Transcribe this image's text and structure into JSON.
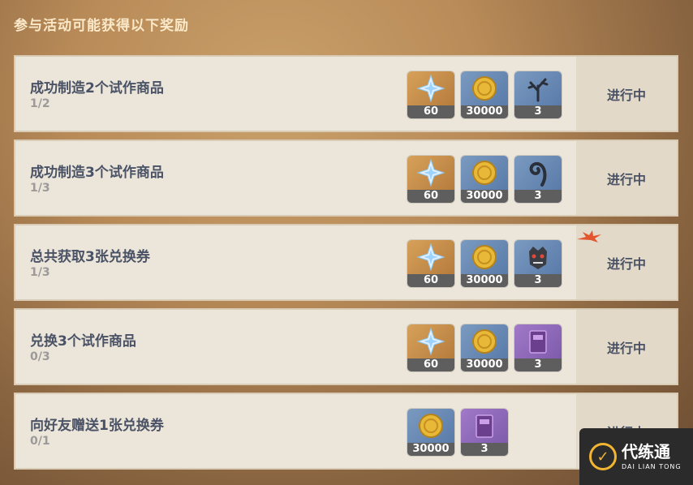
{
  "header": {
    "title": "参与活动可能获得以下奖励"
  },
  "tasks": [
    {
      "name": "成功制造2个试作商品",
      "progress": "1/2",
      "status": "进行中",
      "rewards": [
        {
          "icon": "primogem-icon",
          "count": "60"
        },
        {
          "icon": "mora-coin-icon",
          "count": "30000"
        },
        {
          "icon": "branch-material-icon",
          "count": "3"
        }
      ]
    },
    {
      "name": "成功制造3个试作商品",
      "progress": "1/3",
      "status": "进行中",
      "rewards": [
        {
          "icon": "primogem-icon",
          "count": "60"
        },
        {
          "icon": "mora-coin-icon",
          "count": "30000"
        },
        {
          "icon": "spiral-horn-material-icon",
          "count": "3"
        }
      ]
    },
    {
      "name": "总共获取3张兑换券",
      "progress": "1/3",
      "status": "进行中",
      "rewards": [
        {
          "icon": "primogem-icon",
          "count": "60"
        },
        {
          "icon": "mora-coin-icon",
          "count": "30000"
        },
        {
          "icon": "hilichurl-mask-material-icon",
          "count": "3"
        }
      ]
    },
    {
      "name": "兑换3个试作商品",
      "progress": "0/3",
      "status": "进行中",
      "rewards": [
        {
          "icon": "primogem-icon",
          "count": "60"
        },
        {
          "icon": "mora-coin-icon",
          "count": "30000"
        },
        {
          "icon": "experience-book-icon",
          "count": "3"
        }
      ]
    },
    {
      "name": "向好友赠送1张兑换券",
      "progress": "0/1",
      "status": "进行中",
      "rewards": [
        {
          "icon": "mora-coin-icon",
          "count": "30000"
        },
        {
          "icon": "experience-book-icon",
          "count": "3"
        }
      ]
    }
  ],
  "watermark": {
    "brand_cn": "代练通",
    "brand_en": "DAI LIAN TONG"
  }
}
